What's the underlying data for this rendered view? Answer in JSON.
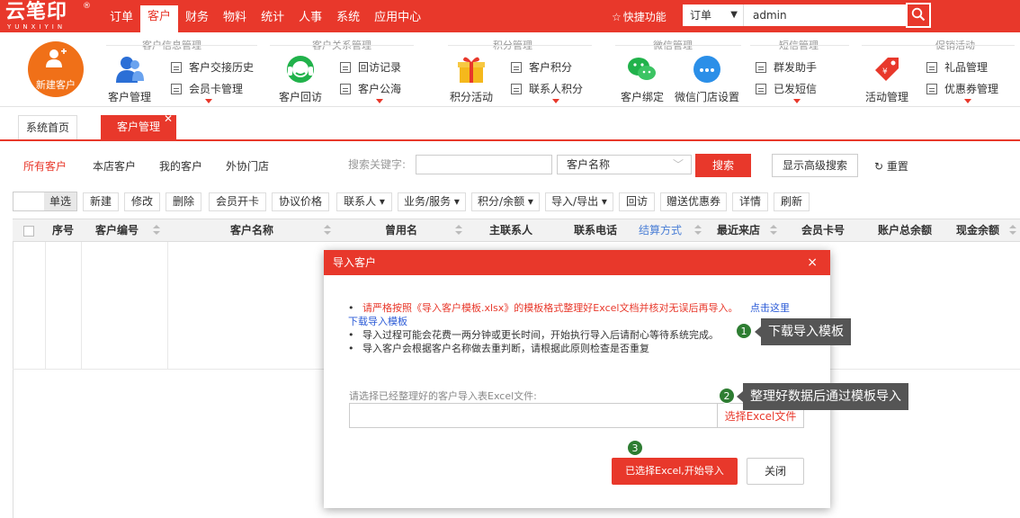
{
  "brand": {
    "logo_text": "云笔印",
    "logo_sub": "YUNXIYIN",
    "reg": "®"
  },
  "nav": {
    "items": [
      "订单",
      "客户",
      "财务",
      "物料",
      "统计",
      "人事",
      "系统",
      "应用中心"
    ],
    "active": "客户"
  },
  "top_right": {
    "quick": "快捷功能",
    "select": "订单",
    "search_value": "admin"
  },
  "ribbon": {
    "new_customer": "新建客户",
    "groups": {
      "info": "客户信息管理",
      "relation": "客户关系管理",
      "points": "积分管理",
      "wechat": "微信管理",
      "sms": "短信管理",
      "promo": "促销活动"
    },
    "info_manage": "客户管理",
    "info_history": "客户交接历史",
    "info_member": "会员卡管理",
    "rel_visit": "客户回访",
    "rel_record": "回访记录",
    "rel_public": "客户公海",
    "pts_activity": "积分活动",
    "pts_customer": "客户积分",
    "pts_contact": "联系人积分",
    "wx_bind": "客户绑定",
    "wx_store": "微信门店设置",
    "sms_mass": "群发助手",
    "sms_sent": "已发短信",
    "promo_activity": "活动管理",
    "promo_gift": "礼品管理",
    "promo_coupon": "优惠券管理"
  },
  "tabs": {
    "home": "系统首页",
    "active": "客户管理"
  },
  "filters": {
    "all": "所有客户",
    "store": "本店客户",
    "mine": "我的客户",
    "external": "外协门店",
    "kw_label": "搜索关键字:",
    "kw_select": "客户名称",
    "search_btn": "搜索",
    "advanced_btn": "显示高级搜索",
    "reset": "重置"
  },
  "toolbar": {
    "toggle_label": "单选",
    "buttons": [
      "新建",
      "修改",
      "删除",
      "会员开卡",
      "协议价格",
      "联系人 ▾",
      "业务/服务 ▾",
      "积分/余额 ▾",
      "导入/导出 ▾",
      "回访",
      "赠送优惠券",
      "详情",
      "刷新"
    ]
  },
  "table": {
    "headers": [
      "序号",
      "客户编号",
      "客户名称",
      "曾用名",
      "主联系人",
      "联系电话",
      "结算方式",
      "最近来店",
      "会员卡号",
      "账户总余额",
      "现金余额"
    ]
  },
  "modal": {
    "title": "导入客户",
    "close": "×",
    "note1": "请严格按照《导入客户模板.xlsx》的模板格式整理好Excel文档并核对无误后再导入。",
    "note1_link": "点击这里",
    "note1_link2": "下载导入模板",
    "note2": "导入过程可能会花费一两分钟或更长时间，开始执行导入后请耐心等待系统完成。",
    "note3": "导入客户会根据客户名称做去重判断，请根据此原则检查是否重复",
    "file_label": "请选择已经整理好的客户导入表Excel文件:",
    "file_btn": "选择Excel文件",
    "start_btn": "已选择Excel,开始导入",
    "close_btn": "关闭"
  },
  "annotations": {
    "step1": "1",
    "step1_text": "下载导入模板",
    "step2": "2",
    "step2_text": "整理好数据后通过模板导入",
    "step3": "3"
  }
}
